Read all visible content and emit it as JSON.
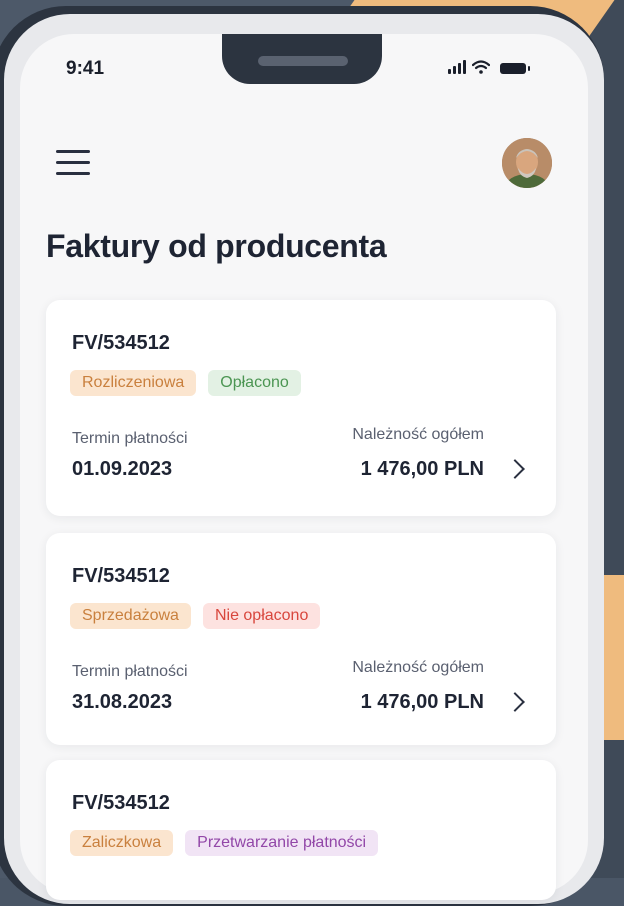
{
  "status_bar": {
    "time": "9:41"
  },
  "header": {
    "title": "Faktury od producenta"
  },
  "invoices": [
    {
      "number": "FV/534512",
      "type_tag": "Rozliczeniowa",
      "status_tag": "Opłacono",
      "due_label": "Termin płatności",
      "due_date": "01.09.2023",
      "total_label": "Należność ogółem",
      "total": "1 476,00 PLN"
    },
    {
      "number": "FV/534512",
      "type_tag": "Sprzedażowa",
      "status_tag": "Nie opłacono",
      "due_label": "Termin płatności",
      "due_date": "31.08.2023",
      "total_label": "Należność ogółem",
      "total": "1 476,00 PLN"
    },
    {
      "number": "FV/534512",
      "type_tag": "Zaliczkowa",
      "status_tag": "Przetwarzanie płatności"
    }
  ],
  "colors": {
    "tag_type_bg": "#fbe5cf",
    "tag_paid_bg": "#e3f1e4",
    "tag_unpaid_bg": "#fde2e0",
    "tag_processing_bg": "#f1e4f5",
    "accent": "#efbb7e"
  }
}
